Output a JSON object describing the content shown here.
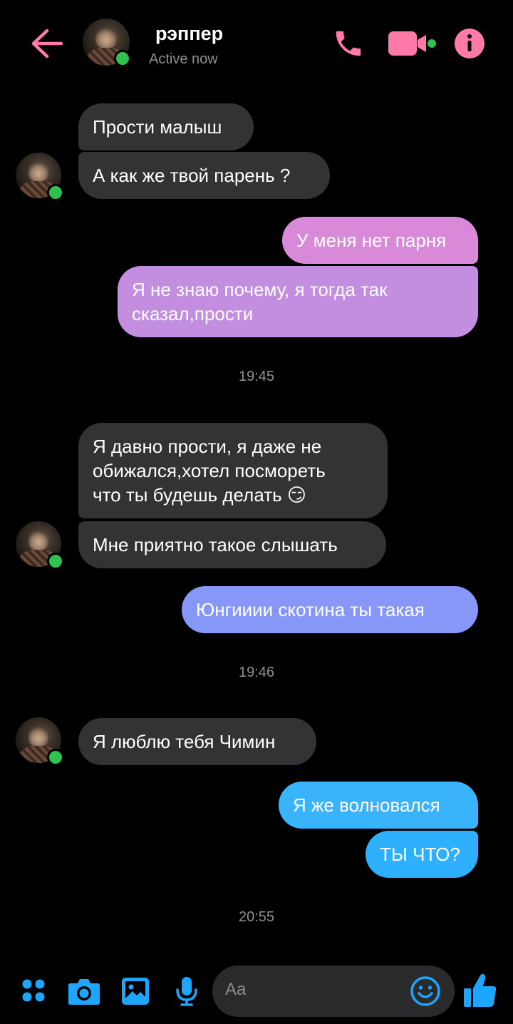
{
  "header": {
    "contact_name": "рэппер",
    "status": "Active now"
  },
  "colors": {
    "accent_pink": "#ff7aa8",
    "online_green": "#31c24d",
    "incoming_bubble": "#333336",
    "outgoing_pink_top": "#d889d8",
    "outgoing_purple_bottom": "#b391ea",
    "outgoing_blue": "#8797f7",
    "outgoing_cyan": "#2fb0ff",
    "composer_icon": "#1ea6ff"
  },
  "messages": [
    {
      "direction": "incoming",
      "text": "Прости малыш"
    },
    {
      "direction": "incoming",
      "text": "А как же твой парень ?"
    },
    {
      "direction": "outgoing",
      "text": "У меня нет парня"
    },
    {
      "direction": "outgoing",
      "text": "Я не знаю почему, я тогда так\nсказал,прости"
    },
    {
      "direction": "time",
      "text": "19:45"
    },
    {
      "direction": "incoming",
      "text": "Я давно прости, я даже не\nобижался,хотел посмореть\nчто ты будешь делать 😏"
    },
    {
      "direction": "incoming",
      "text": "Мне приятно такое слышать"
    },
    {
      "direction": "outgoing",
      "text": "Юнгииии скотина ты такая"
    },
    {
      "direction": "time",
      "text": "19:46"
    },
    {
      "direction": "incoming",
      "text": "Я люблю тебя Чимин"
    },
    {
      "direction": "outgoing",
      "text": "Я же волновался"
    },
    {
      "direction": "outgoing",
      "text": "ТЫ ЧТО?"
    },
    {
      "direction": "time",
      "text": "20:55"
    }
  ],
  "composer": {
    "placeholder": "Aa",
    "icons": [
      "menu-dots-icon",
      "camera-icon",
      "gallery-icon",
      "microphone-icon",
      "emoji-icon",
      "thumbs-up-icon"
    ]
  }
}
